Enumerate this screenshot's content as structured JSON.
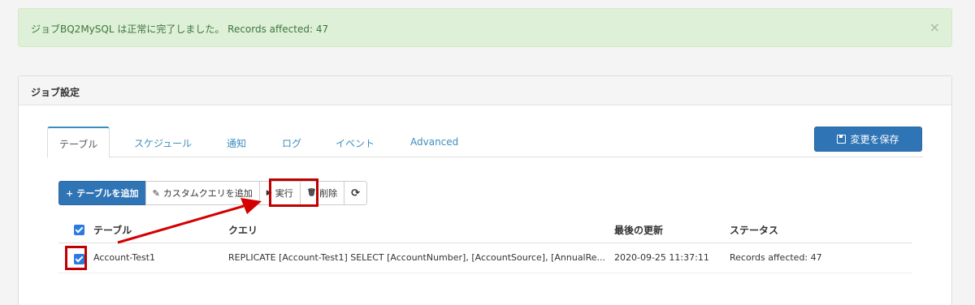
{
  "alert": {
    "message": "ジョブBQ2MySQL は正常に完了しました。 Records affected: 47",
    "close_glyph": "×"
  },
  "panel": {
    "title": "ジョブ設定"
  },
  "tabs": [
    {
      "label": "テーブル",
      "active": true
    },
    {
      "label": "スケジュール",
      "active": false
    },
    {
      "label": "通知",
      "active": false
    },
    {
      "label": "ログ",
      "active": false
    },
    {
      "label": "イベント",
      "active": false
    },
    {
      "label": "Advanced",
      "active": false
    }
  ],
  "save_button": {
    "label": "変更を保存",
    "icon": "floppy-disk-icon"
  },
  "toolbar": {
    "add_table": {
      "glyph": "+",
      "label": "テーブルを追加"
    },
    "custom_query": {
      "glyph": "✎",
      "label": "カスタムクエリを追加"
    },
    "run": {
      "glyph": "▶",
      "label": "実行"
    },
    "delete": {
      "glyph": "🗑",
      "label": "削除"
    },
    "refresh": {
      "glyph": "⟳"
    }
  },
  "table": {
    "headers": {
      "table": "テーブル",
      "query": "クエリ",
      "updated": "最後の更新",
      "status": "ステータス"
    },
    "rows": [
      {
        "checked": true,
        "table": "Account-Test1",
        "query": "REPLICATE [Account-Test1] SELECT [AccountNumber], [AccountSource], [AnnualRe...",
        "updated": "2020-09-25 11:37:11",
        "status": "Records affected: 47"
      }
    ]
  },
  "colors": {
    "accent": "#2f74b5",
    "alert_bg": "#dff0d8",
    "alert_text": "#3c763d",
    "highlight": "#c00000",
    "checkbox": "#2a7ae2"
  }
}
